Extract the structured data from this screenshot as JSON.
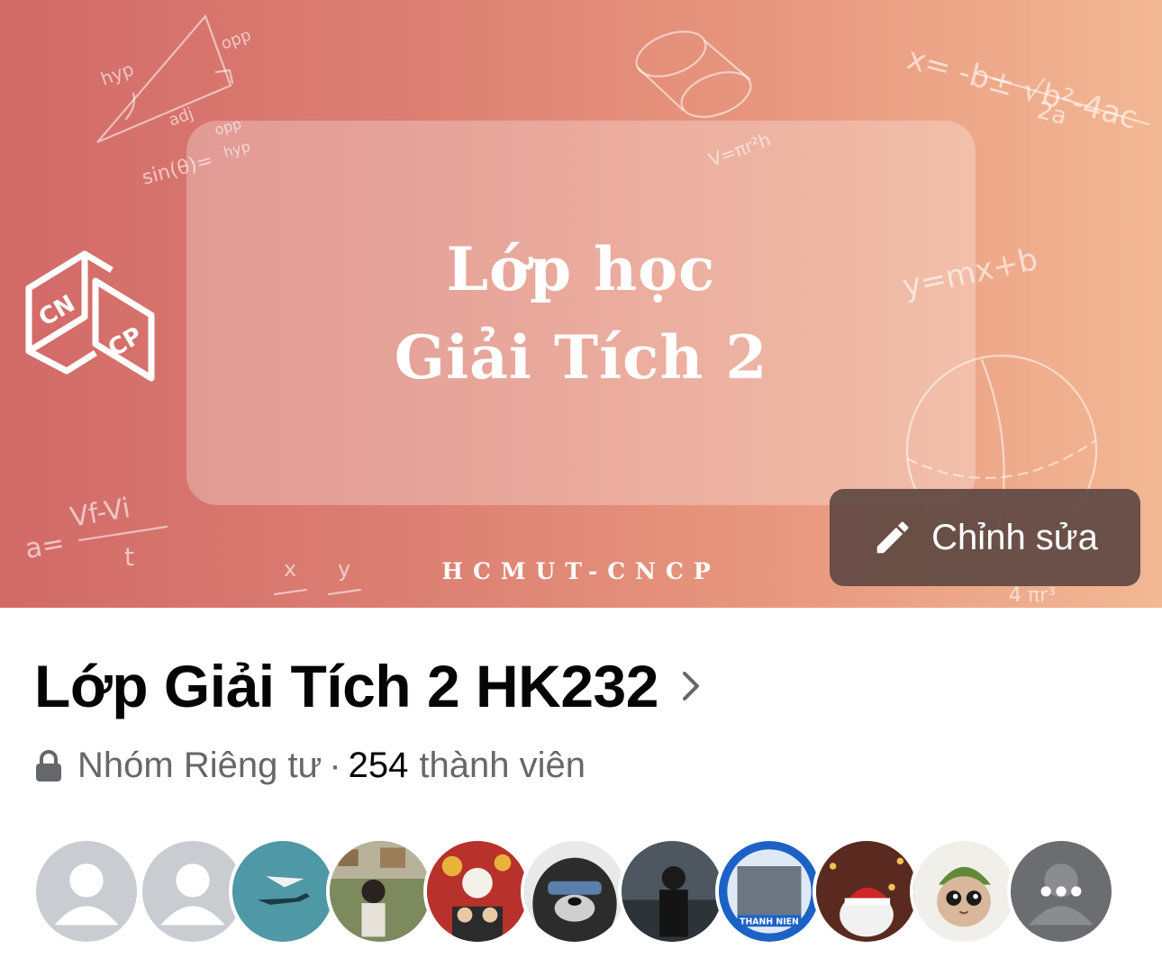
{
  "cover": {
    "title_line1": "Lớp học",
    "title_line2": "Giải Tích 2",
    "footer": "HCMUT-CNCP",
    "logo_top": "CN",
    "logo_bottom": "CP",
    "edit_label": "Chỉnh sửa",
    "edit_icon": "pencil-icon"
  },
  "group": {
    "name": "Lớp Giải Tích 2 HK232",
    "privacy": "Nhóm Riêng tư",
    "separator": "·",
    "member_count": "254",
    "member_label": "thành viên"
  },
  "members": {
    "more_icon": "more-dots-icon",
    "badge_text": "THANH NIEN"
  },
  "colors": {
    "cover_left": "#d26a68",
    "cover_right": "#f2b894",
    "edit_button_bg": "#5e4842",
    "secondary_text": "#65676b",
    "primary_text": "#050505"
  }
}
